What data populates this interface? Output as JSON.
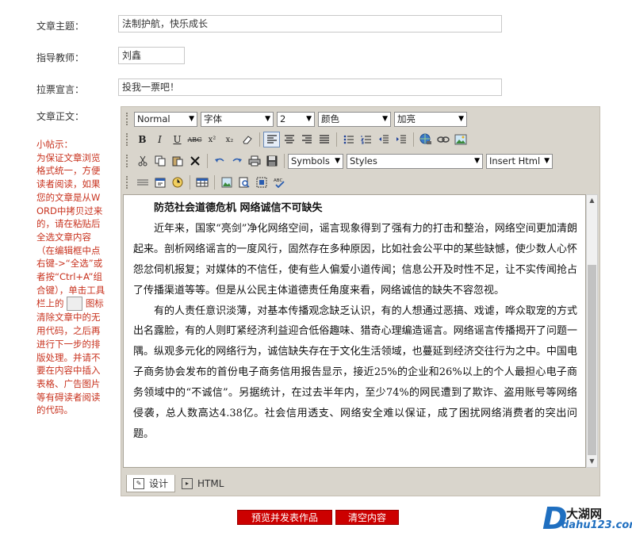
{
  "form": {
    "topic": {
      "label": "文章主题：",
      "value": "法制护航，快乐成长"
    },
    "teacher": {
      "label": "指导教师：",
      "value": "刘鑫"
    },
    "slogan": {
      "label": "拉票宣言：",
      "value": "投我一票吧！"
    },
    "body_label": "文章正文："
  },
  "tip": {
    "head": "小帖示：",
    "text_before": "为保证文章浏览格式统一，方便读者阅读，如果您的文章是从WORD中拷贝过来的，请在粘贴后全选文章内容（在编辑框中点右键->“全选”或者按“Ctrl+A”组合键），单击工具栏上的",
    "text_after": "图标清除文章中的无用代码，之后再进行下一步的排版处理。并请不要在内容中插入表格、广告图片等有碍读者阅读的代码。"
  },
  "toolbar": {
    "format": "Normal",
    "font": "字体",
    "size": "2",
    "color": "颜色",
    "highlight": "加亮",
    "symbols": "Symbols",
    "styles": "Styles",
    "insert_html": "Insert Html",
    "bold": "B",
    "italic": "I",
    "underline": "U",
    "strike": "ABC",
    "sup": "x²",
    "sub": "x₂"
  },
  "content": {
    "title": "防范社会道德危机 网络诚信不可缺失",
    "p1": "近年来，国家“亮剑”净化网络空间，谣言现象得到了强有力的打击和整治，网络空间更加清朗起来。剖析网络谣言的一度风行，固然存在多种原因，比如社会公平中的某些缺憾，使少数人心怀怨忿伺机报复；对媒体的不信任，使有些人偏爱小道传闻；信息公开及时性不足，让不实传闻抢占了传播渠道等等。但是从公民主体道德责任角度来看，网络诚信的缺失不容忽视。",
    "p2": "有的人责任意识淡薄，对基本传播观念缺乏认识，有的人想通过恶搞、戏谑，哗众取宠的方式出名露脸，有的人则盯紧经济利益迎合低俗趣味、猎奇心理编造谣言。网络谣言传播揭开了问题一隅。纵观多元化的网络行为，诚信缺失存在于文化生活领域，也蔓延到经济交往行为之中。中国电子商务协会发布的首份电子商务信用报告显示，接近25%的企业和26%以上的个人最担心电子商务领域中的“不诚信”。另据统计，在过去半年内，至少74%的网民遭到了欺诈、盗用账号等网络侵袭，总人数高达4.38亿。社会信用透支、网络安全难以保证，成了困扰网络消费者的突出问题。"
  },
  "tabs": {
    "design": "设计",
    "html": "HTML"
  },
  "buttons": {
    "preview": "预览并发表作品",
    "clear": "清空内容"
  },
  "logo": {
    "letter": "D",
    "name": "大湖网",
    "url": "dahu123.com"
  }
}
